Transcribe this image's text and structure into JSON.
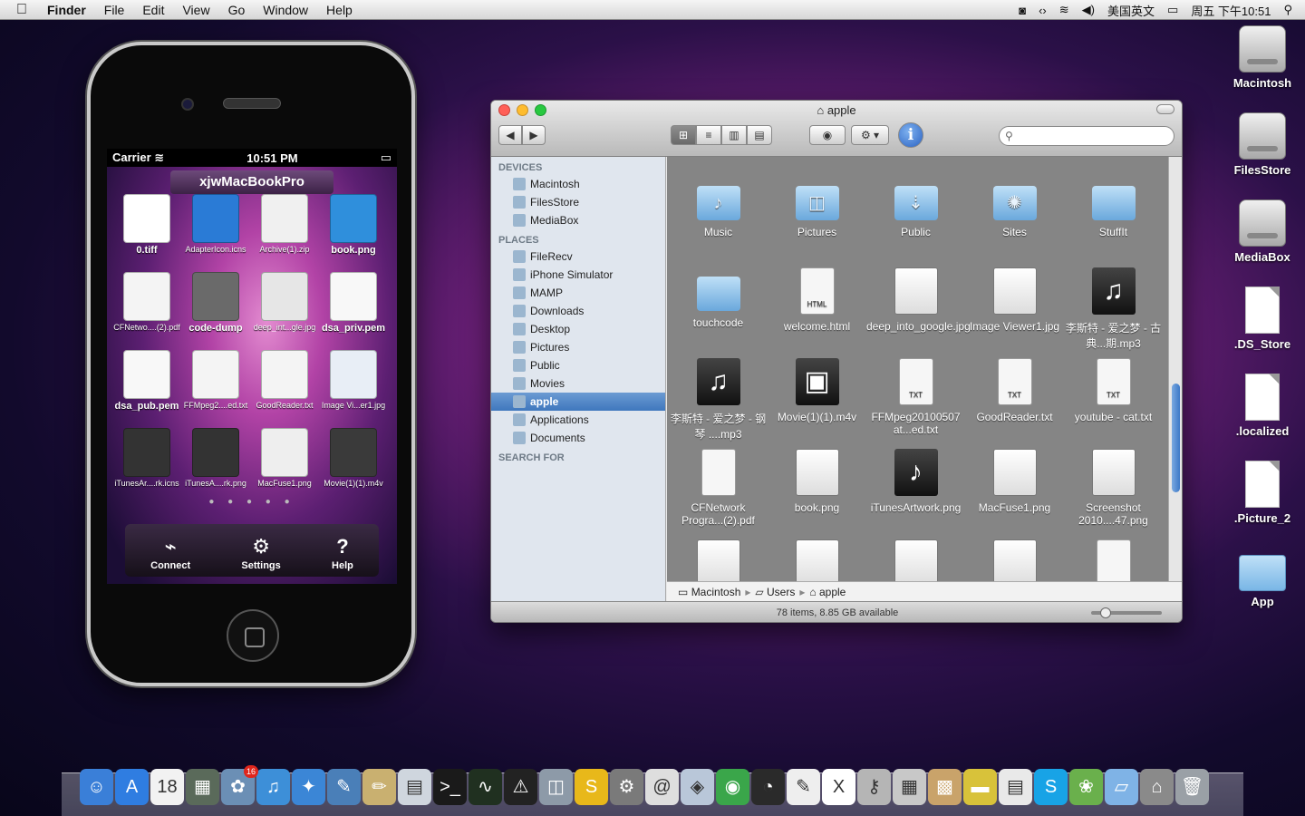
{
  "menubar": {
    "apple": "",
    "app": "Finder",
    "items": [
      "File",
      "Edit",
      "View",
      "Go",
      "Window",
      "Help"
    ],
    "input_method": "美国英文",
    "clock": "周五 下午10:51"
  },
  "desktop_icons": [
    {
      "label": "Macintosh",
      "type": "drive"
    },
    {
      "label": "FilesStore",
      "type": "drive"
    },
    {
      "label": "MediaBox",
      "type": "drive"
    },
    {
      "label": ".DS_Store",
      "type": "doc"
    },
    {
      "label": ".localized",
      "type": "doc"
    },
    {
      "label": ".Picture_2",
      "type": "doc"
    },
    {
      "label": "App",
      "type": "folder"
    }
  ],
  "iphone": {
    "carrier": "Carrier",
    "time": "10:51 PM",
    "device_name": "xjwMacBookPro",
    "files": [
      {
        "label": "0.tiff",
        "big": true,
        "color": "#ffffff"
      },
      {
        "label": "AdapterIcon.icns",
        "big": false,
        "color": "#2a7bd6"
      },
      {
        "label": "Archive(1).zip",
        "big": false,
        "color": "#f0f0f0"
      },
      {
        "label": "book.png",
        "big": true,
        "color": "#2f8fdc"
      },
      {
        "label": "CFNetwo....(2).pdf",
        "big": false,
        "color": "#f4f4f4"
      },
      {
        "label": "code-dump",
        "big": true,
        "color": "#6a6a6a"
      },
      {
        "label": "deep_int...gle.jpg",
        "big": false,
        "color": "#e6e6e6"
      },
      {
        "label": "dsa_priv.pem",
        "big": true,
        "color": "#f8f8f8"
      },
      {
        "label": "dsa_pub.pem",
        "big": true,
        "color": "#f8f8f8"
      },
      {
        "label": "FFMpeg2....ed.txt",
        "big": false,
        "color": "#f4f4f4"
      },
      {
        "label": "GoodReader.txt",
        "big": false,
        "color": "#f4f4f4"
      },
      {
        "label": "Image Vi...er1.jpg",
        "big": false,
        "color": "#e8eef6"
      },
      {
        "label": "iTunesAr....rk.icns",
        "big": false,
        "color": "#333333"
      },
      {
        "label": "iTunesA....rk.png",
        "big": false,
        "color": "#333333"
      },
      {
        "label": "MacFuse1.png",
        "big": false,
        "color": "#eeeeee"
      },
      {
        "label": "Movie(1)(1).m4v",
        "big": false,
        "color": "#3a3a3a"
      }
    ],
    "page_dots": "● ● ● ● ●",
    "tabs": [
      {
        "label": "Connect",
        "icon": "satellite-dish-icon",
        "glyph": "⌁"
      },
      {
        "label": "Settings",
        "icon": "gear-icon",
        "glyph": "⚙"
      },
      {
        "label": "Help",
        "icon": "question-icon",
        "glyph": "?"
      }
    ]
  },
  "finder": {
    "title": "apple",
    "view_buttons": [
      "⊞",
      "≡",
      "▥",
      "▤"
    ],
    "quicklook": "◉",
    "action": "⚙ ▾",
    "info": "i",
    "search_placeholder": "",
    "sidebar": {
      "devices_header": "DEVICES",
      "devices": [
        "Macintosh",
        "FilesStore",
        "MediaBox"
      ],
      "places_header": "PLACES",
      "places": [
        "FileRecv",
        "iPhone Simulator",
        "MAMP",
        "Downloads",
        "Desktop",
        "Pictures",
        "Public",
        "Movies",
        "apple",
        "Applications",
        "Documents"
      ],
      "selected": "apple",
      "search_header": "SEARCH FOR"
    },
    "items": [
      {
        "label": "Music",
        "kind": "folder",
        "glyph": "♪"
      },
      {
        "label": "Pictures",
        "kind": "folder",
        "glyph": "◫"
      },
      {
        "label": "Public",
        "kind": "folder",
        "glyph": "⇣"
      },
      {
        "label": "Sites",
        "kind": "folder",
        "glyph": "✺"
      },
      {
        "label": "StuffIt",
        "kind": "folder",
        "glyph": ""
      },
      {
        "label": "touchcode",
        "kind": "folder",
        "glyph": ""
      },
      {
        "label": "welcome.html",
        "kind": "doc",
        "glyph": "HTML"
      },
      {
        "label": "deep_into_google.jpg",
        "kind": "img",
        "glyph": ""
      },
      {
        "label": "Image Viewer1.jpg",
        "kind": "img",
        "glyph": ""
      },
      {
        "label": "李斯特 - 爱之梦 - 古典...期.mp3",
        "kind": "music",
        "glyph": "♫"
      },
      {
        "label": "李斯特 - 爱之梦 - 钢琴 ....mp3",
        "kind": "music",
        "glyph": "♫"
      },
      {
        "label": "Movie(1)(1).m4v",
        "kind": "music",
        "glyph": "▣"
      },
      {
        "label": "FFMpeg20100507 at...ed.txt",
        "kind": "doc",
        "glyph": "TXT"
      },
      {
        "label": "GoodReader.txt",
        "kind": "doc",
        "glyph": "TXT"
      },
      {
        "label": "youtube - cat.txt",
        "kind": "doc",
        "glyph": "TXT"
      },
      {
        "label": "CFNetwork Progra...(2).pdf",
        "kind": "doc",
        "glyph": ""
      },
      {
        "label": "book.png",
        "kind": "img",
        "glyph": ""
      },
      {
        "label": "iTunesArtwork.png",
        "kind": "music",
        "glyph": "♪"
      },
      {
        "label": "MacFuse1.png",
        "kind": "img",
        "glyph": ""
      },
      {
        "label": "Screenshot 2010....47.png",
        "kind": "img",
        "glyph": ""
      },
      {
        "label": "",
        "kind": "img",
        "glyph": ""
      },
      {
        "label": "",
        "kind": "img",
        "glyph": ""
      },
      {
        "label": "",
        "kind": "img",
        "glyph": ""
      },
      {
        "label": "",
        "kind": "img",
        "glyph": ""
      },
      {
        "label": "",
        "kind": "doc",
        "glyph": ""
      }
    ],
    "path": [
      "Macintosh",
      "Users",
      "apple"
    ],
    "status": "78 items, 8.85 GB available",
    "icon_size_level": 0.15
  },
  "dock": {
    "apps": [
      {
        "icon": "finder-icon",
        "color": "#3a7fd8",
        "glyph": "☺"
      },
      {
        "icon": "app-store-icon",
        "color": "#2f7de1",
        "glyph": "A"
      },
      {
        "icon": "calendar-icon",
        "color": "#f2f2f2",
        "glyph": "18"
      },
      {
        "icon": "photo-browser-icon",
        "color": "#5a6a5a",
        "glyph": "▦"
      },
      {
        "icon": "iphoto-icon",
        "color": "#6b8fb5",
        "glyph": "✿"
      },
      {
        "icon": "itunes-icon",
        "color": "#3d8fd8",
        "glyph": "♫"
      },
      {
        "icon": "safari-icon",
        "color": "#3b86d6",
        "glyph": "✦"
      },
      {
        "icon": "xcode-icon",
        "color": "#4a7fb8",
        "glyph": "✎"
      },
      {
        "icon": "pencil-app-icon",
        "color": "#c9b070",
        "glyph": "✏"
      },
      {
        "icon": "preview-icon",
        "color": "#cfd6de",
        "glyph": "▤"
      },
      {
        "icon": "terminal-icon",
        "color": "#1a1a1a",
        "glyph": ">_"
      },
      {
        "icon": "activity-monitor-icon",
        "color": "#203020",
        "glyph": "∿"
      },
      {
        "icon": "console-icon",
        "color": "#222222",
        "glyph": "⚠"
      },
      {
        "icon": "image-capture-icon",
        "color": "#8d9aa8",
        "glyph": "◫"
      },
      {
        "icon": "stuffit-icon",
        "color": "#e8b81a",
        "glyph": "S"
      },
      {
        "icon": "system-prefs-icon",
        "color": "#7a7a7a",
        "glyph": "⚙"
      },
      {
        "icon": "contacts-icon",
        "color": "#dedede",
        "glyph": "@"
      },
      {
        "icon": "package-icon",
        "color": "#b9c7d9",
        "glyph": "◈"
      },
      {
        "icon": "chrome-icon",
        "color": "#3aa64a",
        "glyph": "◉"
      },
      {
        "icon": "dashboard-icon",
        "color": "#2a2a2a",
        "glyph": "◔"
      },
      {
        "icon": "textedit-icon",
        "color": "#eeeeee",
        "glyph": "✎"
      },
      {
        "icon": "x11-icon",
        "color": "#ffffff",
        "glyph": "X"
      },
      {
        "icon": "keychain-icon",
        "color": "#b5b5b5",
        "glyph": "⚷"
      },
      {
        "icon": "calculator-icon",
        "color": "#c8c8c8",
        "glyph": "▦"
      },
      {
        "icon": "grid-app-icon",
        "color": "#c9a36a",
        "glyph": "▩"
      },
      {
        "icon": "drive-icon",
        "color": "#d8c23a",
        "glyph": "▬"
      },
      {
        "icon": "document-icon",
        "color": "#e9e9e9",
        "glyph": "▤"
      },
      {
        "icon": "skype-icon",
        "color": "#18a3e6",
        "glyph": "S"
      },
      {
        "icon": "lotus-icon",
        "color": "#6ab04c",
        "glyph": "❀"
      },
      {
        "icon": "folder-stack-icon",
        "color": "#7fb3e6",
        "glyph": "▱"
      },
      {
        "icon": "hanger-icon",
        "color": "#8a8a8a",
        "glyph": "⌂"
      },
      {
        "icon": "trash-icon",
        "color": "#9aa0a6",
        "glyph": "🗑"
      }
    ],
    "calendar_badge": "16"
  },
  "colors": {
    "accent": "#3f77bd",
    "close": "#ff5f57",
    "minimize": "#febc2e",
    "zoom": "#28c840"
  }
}
